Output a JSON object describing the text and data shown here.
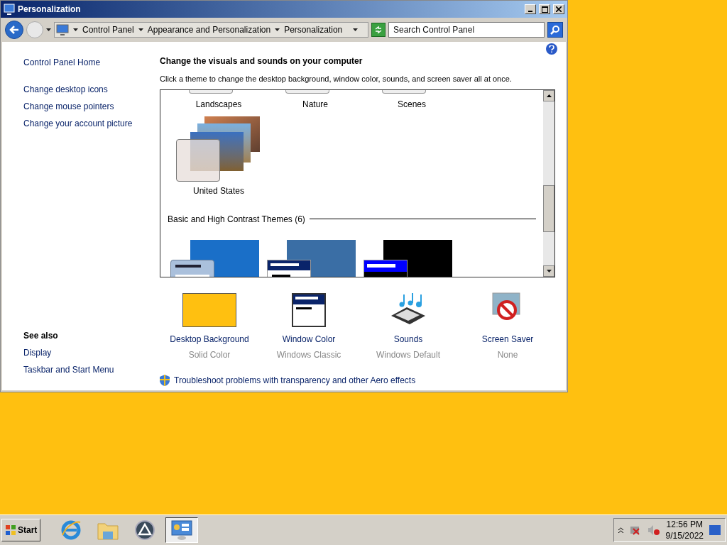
{
  "window": {
    "title": "Personalization"
  },
  "address_bar": {
    "crumbs": [
      "Control Panel",
      "Appearance and Personalization",
      "Personalization"
    ]
  },
  "search": {
    "placeholder": "Search Control Panel"
  },
  "sidebar": {
    "links": [
      "Control Panel Home",
      "Change desktop icons",
      "Change mouse pointers",
      "Change your account picture"
    ],
    "see_also_title": "See also",
    "see_also": [
      "Display",
      "Taskbar and Start Menu"
    ]
  },
  "main": {
    "heading": "Change the visuals and sounds on your computer",
    "description": "Click a theme to change the desktop background, window color, sounds, and screen saver all at once."
  },
  "gallery": {
    "top_row": [
      "Landscapes",
      "Nature",
      "Scenes"
    ],
    "themes": [
      "United States"
    ],
    "basic_section": "Basic and High Contrast Themes (6)",
    "basic_themes": [
      {
        "kind": "aero"
      },
      {
        "kind": "classic"
      },
      {
        "kind": "contrast"
      }
    ]
  },
  "settings": [
    {
      "kind": "background",
      "label": "Desktop Background",
      "value": "Solid Color"
    },
    {
      "kind": "window",
      "label": "Window Color",
      "value": "Windows Classic"
    },
    {
      "kind": "sounds",
      "label": "Sounds",
      "value": "Windows Default"
    },
    {
      "kind": "screensaver",
      "label": "Screen Saver",
      "value": "None"
    }
  ],
  "troubleshoot_link": "Troubleshoot problems with transparency and other Aero effects",
  "taskbar": {
    "start": "Start",
    "apps": [
      {
        "kind": "browser",
        "selected": false
      },
      {
        "kind": "folder",
        "selected": false
      },
      {
        "kind": "app",
        "selected": false
      },
      {
        "kind": "control",
        "selected": true
      }
    ],
    "time": "12:56 PM",
    "date": "9/15/2022"
  }
}
